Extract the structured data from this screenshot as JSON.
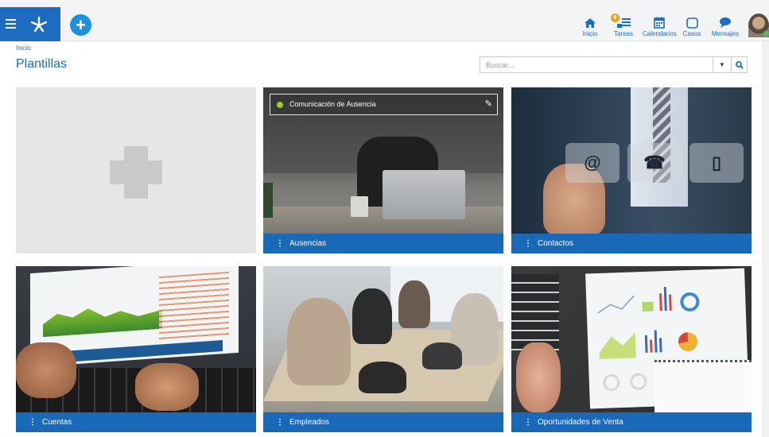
{
  "topbar": {
    "nav": [
      {
        "label": "Inicio",
        "icon": "home-icon"
      },
      {
        "label": "Tareas",
        "icon": "tasks-icon",
        "badge": "8"
      },
      {
        "label": "Calendarios",
        "icon": "calendar-icon"
      },
      {
        "label": "Casos",
        "icon": "cases-icon"
      },
      {
        "label": "Mensajes",
        "icon": "messages-icon"
      }
    ],
    "add_label": "+",
    "accent": "#1e6cc0"
  },
  "breadcrumb": "Inicio",
  "page_title": "Plantillas",
  "search": {
    "placeholder": "Buscar...",
    "value": ""
  },
  "tiles": [
    {
      "label": "",
      "kind": "new"
    },
    {
      "label": "Ausencias",
      "hover_title": "Comunicación de Ausencia"
    },
    {
      "label": "Contactos",
      "icons": [
        "@",
        "☎",
        "▯"
      ]
    },
    {
      "label": "Cuentas"
    },
    {
      "label": "Empleados"
    },
    {
      "label": "Oportunidades de Venta"
    }
  ],
  "caption_color": "#1a68b8"
}
